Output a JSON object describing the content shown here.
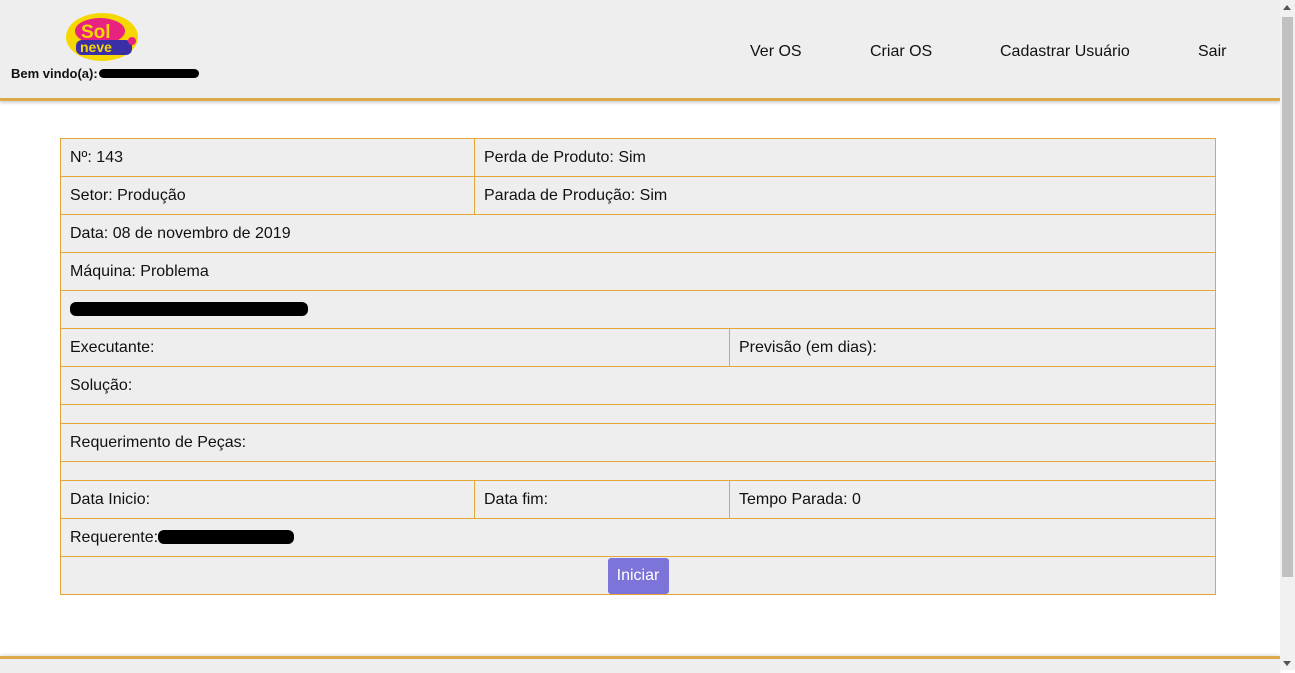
{
  "header": {
    "logo_text_top": "Sol",
    "logo_text_bottom": "neve",
    "welcome_label": "Bem vindo(a):",
    "nav": [
      {
        "label": "Ver OS"
      },
      {
        "label": "Criar OS"
      },
      {
        "label": "Cadastrar Usuário"
      },
      {
        "label": "Sair"
      }
    ]
  },
  "order": {
    "number": "Nº: 143",
    "loss": "Perda de Produto: Sim",
    "sector": "Setor: Produção",
    "stop": "Parada de Produção: Sim",
    "date": "Data: 08 de novembro de 2019",
    "machine": "Máquina: Problema",
    "executor": "Executante:",
    "forecast": "Previsão (em dias):",
    "solution": "Solução:",
    "parts": "Requerimento de Peças:",
    "start_date": "Data Inicio:",
    "end_date": "Data fim:",
    "downtime": "Tempo Parada: 0",
    "requester": "Requerente:"
  },
  "actions": {
    "start_label": "Iniciar"
  },
  "colors": {
    "accent": "#e3a735",
    "button": "#7c74d8",
    "panel": "#eeeeee"
  }
}
